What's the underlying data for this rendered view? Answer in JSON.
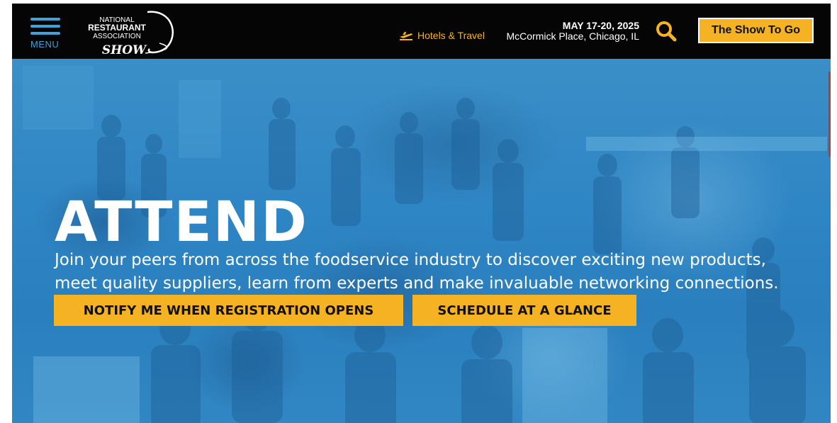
{
  "header": {
    "menu_label": "MENU",
    "logo": {
      "line1": "NATIONAL",
      "line2": "RESTAURANT",
      "line3": "ASSOCIATION",
      "line4": "SHOW"
    },
    "hotels_link": "Hotels & Travel",
    "event_date": "MAY 17-20, 2025",
    "event_venue": "McCormick Place, Chicago, IL",
    "show_to_go": "The Show To Go",
    "icons": {
      "menu": "hamburger-icon",
      "hotels": "airplane-icon",
      "search": "search-icon"
    }
  },
  "hero": {
    "title": "ATTEND",
    "description": "Join your peers from across the foodservice industry to discover exciting new products, meet quality suppliers, learn from experts and make invaluable networking connections.",
    "cta_primary": "NOTIFY ME WHEN REGISTRATION OPENS",
    "cta_secondary": "SCHEDULE AT A GLANCE"
  },
  "colors": {
    "accent": "#f5b324",
    "header_bg": "#050505",
    "hero_overlay": "#2f86c4",
    "menu_blue": "#3fa3d9"
  }
}
